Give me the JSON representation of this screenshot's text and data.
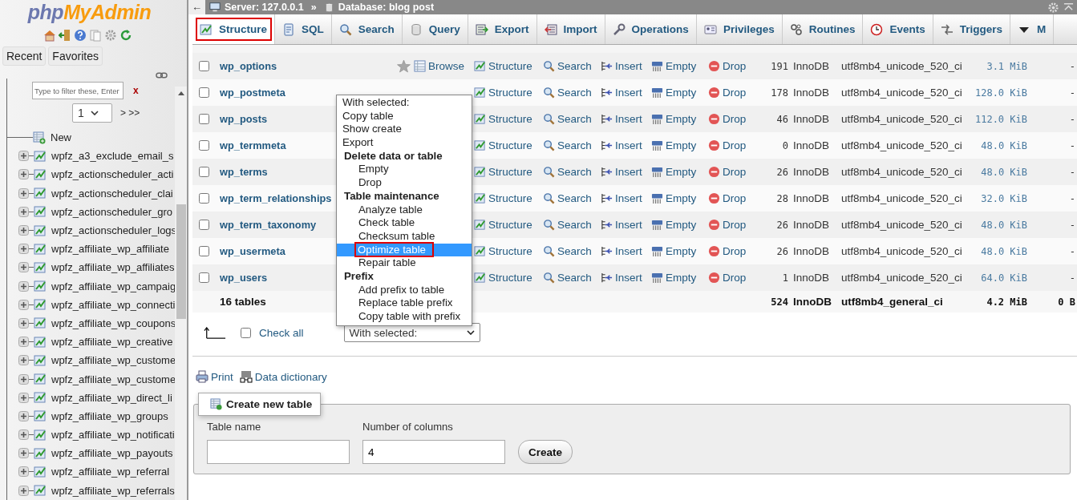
{
  "sidebar": {
    "logo": [
      "php",
      "MyAdmin"
    ],
    "nav_buttons": [
      "Recent",
      "Favorites"
    ],
    "filter": {
      "placeholder": "Type to filter these, Enter"
    },
    "clear": "x",
    "page_select": "1",
    "page_nav": "> >>",
    "new_item": "New",
    "tables": [
      "wpfz_a3_exclude_email_s",
      "wpfz_actionscheduler_acti",
      "wpfz_actionscheduler_clai",
      "wpfz_actionscheduler_gro",
      "wpfz_actionscheduler_logs",
      "wpfz_affiliate_wp_affiliate",
      "wpfz_affiliate_wp_affiliates",
      "wpfz_affiliate_wp_campaig",
      "wpfz_affiliate_wp_connecti",
      "wpfz_affiliate_wp_coupons",
      "wpfz_affiliate_wp_creative",
      "wpfz_affiliate_wp_custome",
      "wpfz_affiliate_wp_custome",
      "wpfz_affiliate_wp_direct_li",
      "wpfz_affiliate_wp_groups",
      "wpfz_affiliate_wp_notificati",
      "wpfz_affiliate_wp_payouts",
      "wpfz_affiliate_wp_referral",
      "wpfz_affiliate_wp_referrals"
    ]
  },
  "breadcrumb": {
    "back": "←",
    "server": "Server: 127.0.0.1",
    "separator": "»",
    "database": "Database: blog post"
  },
  "tabs": [
    {
      "label": "Structure",
      "selected": true
    },
    {
      "label": "SQL",
      "selected": false
    },
    {
      "label": "Search",
      "selected": false
    },
    {
      "label": "Query",
      "selected": false
    },
    {
      "label": "Export",
      "selected": false
    },
    {
      "label": "Import",
      "selected": false
    },
    {
      "label": "Operations",
      "selected": false
    },
    {
      "label": "Privileges",
      "selected": false
    },
    {
      "label": "Routines",
      "selected": false
    },
    {
      "label": "Events",
      "selected": false
    },
    {
      "label": "Triggers",
      "selected": false
    },
    {
      "label": "M",
      "selected": false
    }
  ],
  "table": {
    "rows": [
      {
        "name": "wp_options",
        "checked": false,
        "browse": "Browse",
        "actions": [
          "Structure",
          "Search",
          "Insert",
          "Empty",
          "Drop"
        ],
        "rows": "191",
        "engine": "InnoDB",
        "collation": "utf8mb4_unicode_520_ci",
        "size": "3.1 MiB",
        "overhead": "-"
      },
      {
        "name": "wp_postmeta",
        "checked": false,
        "actions": [
          "Structure",
          "Search",
          "Insert",
          "Empty",
          "Drop"
        ],
        "rows": "178",
        "engine": "InnoDB",
        "collation": "utf8mb4_unicode_520_ci",
        "size": "128.0 KiB",
        "overhead": "-"
      },
      {
        "name": "wp_posts",
        "checked": false,
        "actions": [
          "Structure",
          "Search",
          "Insert",
          "Empty",
          "Drop"
        ],
        "rows": "46",
        "engine": "InnoDB",
        "collation": "utf8mb4_unicode_520_ci",
        "size": "112.0 KiB",
        "overhead": "-"
      },
      {
        "name": "wp_termmeta",
        "checked": false,
        "actions": [
          "Structure",
          "Search",
          "Insert",
          "Empty",
          "Drop"
        ],
        "rows": "0",
        "engine": "InnoDB",
        "collation": "utf8mb4_unicode_520_ci",
        "size": "48.0 KiB",
        "overhead": "-"
      },
      {
        "name": "wp_terms",
        "checked": false,
        "actions": [
          "Structure",
          "Search",
          "Insert",
          "Empty",
          "Drop"
        ],
        "rows": "26",
        "engine": "InnoDB",
        "collation": "utf8mb4_unicode_520_ci",
        "size": "48.0 KiB",
        "overhead": "-"
      },
      {
        "name": "wp_term_relationships",
        "checked": false,
        "actions": [
          "Structure",
          "Search",
          "Insert",
          "Empty",
          "Drop"
        ],
        "rows": "28",
        "engine": "InnoDB",
        "collation": "utf8mb4_unicode_520_ci",
        "size": "32.0 KiB",
        "overhead": "-"
      },
      {
        "name": "wp_term_taxonomy",
        "checked": false,
        "actions": [
          "Structure",
          "Search",
          "Insert",
          "Empty",
          "Drop"
        ],
        "rows": "26",
        "engine": "InnoDB",
        "collation": "utf8mb4_unicode_520_ci",
        "size": "48.0 KiB",
        "overhead": "-"
      },
      {
        "name": "wp_usermeta",
        "checked": false,
        "actions": [
          "Structure",
          "Search",
          "Insert",
          "Empty",
          "Drop"
        ],
        "rows": "26",
        "engine": "InnoDB",
        "collation": "utf8mb4_unicode_520_ci",
        "size": "48.0 KiB",
        "overhead": "-"
      },
      {
        "name": "wp_users",
        "checked": false,
        "actions": [
          "Structure",
          "Search",
          "Insert",
          "Empty",
          "Drop"
        ],
        "rows": "1",
        "engine": "InnoDB",
        "collation": "utf8mb4_unicode_520_ci",
        "size": "64.0 KiB",
        "overhead": "-"
      }
    ],
    "summary": {
      "name": "16 tables",
      "rows": "524",
      "engine": "InnoDB",
      "collation": "utf8mb4_general_ci",
      "size": "4.2 MiB",
      "overhead": "0 B"
    }
  },
  "context_menu": {
    "items": [
      {
        "label": "With selected:",
        "kind": "caption",
        "selected": false
      },
      {
        "label": "Copy table",
        "kind": "item",
        "selected": false
      },
      {
        "label": "Show create",
        "kind": "item",
        "selected": false
      },
      {
        "label": "Export",
        "kind": "item",
        "selected": false
      },
      {
        "label": "Delete data or table",
        "kind": "group",
        "selected": false
      },
      {
        "label": "Empty",
        "kind": "sub",
        "selected": false
      },
      {
        "label": "Drop",
        "kind": "sub",
        "selected": false
      },
      {
        "label": "Table maintenance",
        "kind": "group",
        "selected": false
      },
      {
        "label": "Analyze table",
        "kind": "sub",
        "selected": false
      },
      {
        "label": "Check table",
        "kind": "sub",
        "selected": false
      },
      {
        "label": "Checksum table",
        "kind": "sub",
        "selected": false
      },
      {
        "label": "Optimize table",
        "kind": "sub",
        "selected": true
      },
      {
        "label": "Repair table",
        "kind": "sub",
        "selected": false
      },
      {
        "label": "Prefix",
        "kind": "group",
        "selected": false
      },
      {
        "label": "Add prefix to table",
        "kind": "sub",
        "selected": false
      },
      {
        "label": "Replace table prefix",
        "kind": "sub",
        "selected": false
      },
      {
        "label": "Copy table with prefix",
        "kind": "sub",
        "selected": false
      }
    ]
  },
  "bulk": {
    "check_all": {
      "label": "Check all",
      "checked": false
    },
    "select": "With selected:"
  },
  "links": [
    "Print",
    "Data dictionary"
  ],
  "create_table": {
    "legend": "Create new table",
    "name_label": "Table name",
    "columns_label": "Number of columns",
    "columns_value": "4",
    "button": "Create"
  }
}
